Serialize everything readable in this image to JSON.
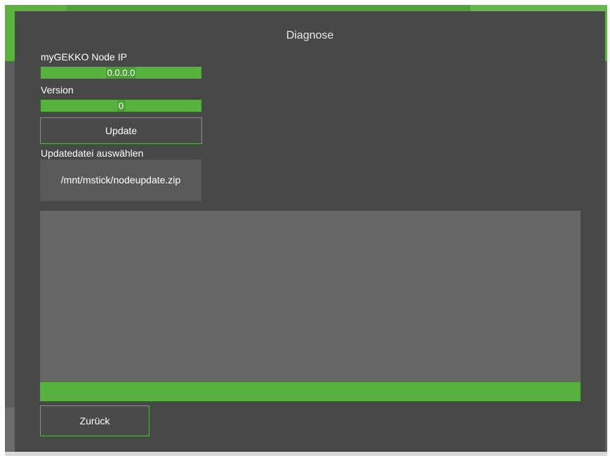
{
  "dialog": {
    "title": "Diagnose",
    "node_ip_label": "myGEKKO Node IP",
    "node_ip_value": "0.0.0.0",
    "version_label": "Version",
    "version_value": "0",
    "update_button": "Update",
    "file_label": "Updatedatei auswählen",
    "file_path": "/mnt/mstick/nodeupdate.zip",
    "log_text": "",
    "progress_fraction": 1.0,
    "back_button": "Zurück"
  },
  "colors": {
    "accent_green": "#59b23f",
    "dialog_bg": "#484848",
    "log_bg": "#676767"
  }
}
